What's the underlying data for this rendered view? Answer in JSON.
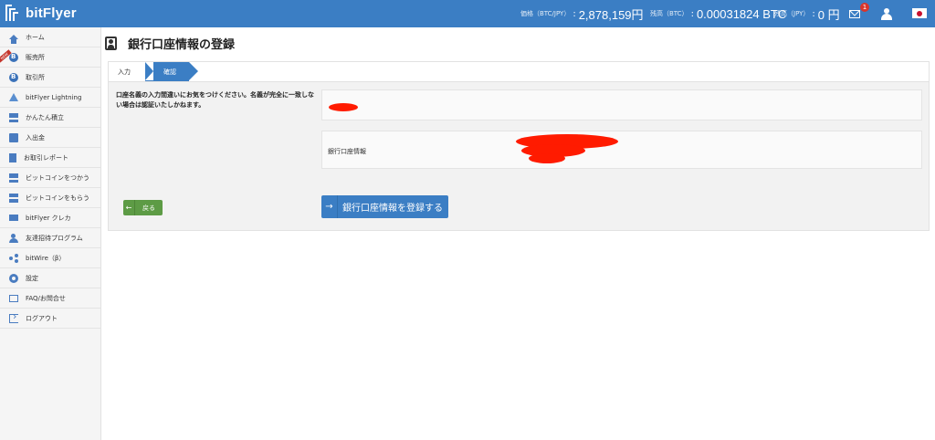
{
  "app": {
    "name": "bitFlyer"
  },
  "header": {
    "price_label": "価格（BTC/JPY）",
    "price_value": "2,878,159円",
    "btc_label": "残高（BTC）",
    "btc_value": "0.00031824 BTC",
    "jpy_label": "残高（JPY）",
    "jpy_value": "0 円",
    "notification_count": "1"
  },
  "sidebar": {
    "ribbon": "NEW",
    "items": [
      {
        "label": "ホーム",
        "icon": "home-icon"
      },
      {
        "label": "販売所",
        "icon": "bitcoin-icon"
      },
      {
        "label": "取引所",
        "icon": "bitcoin-icon"
      },
      {
        "label": "bitFlyer Lightning",
        "icon": "lightning-icon"
      },
      {
        "label": "かんたん積立",
        "icon": "savings-icon"
      },
      {
        "label": "入出金",
        "icon": "deposit-icon"
      },
      {
        "label": "お取引レポート",
        "icon": "report-icon"
      },
      {
        "label": "ビットコインをつかう",
        "icon": "cart-icon"
      },
      {
        "label": "ビットコインをもらう",
        "icon": "gift-icon"
      },
      {
        "label": "bitFlyer クレカ",
        "icon": "credit-card-icon"
      },
      {
        "label": "友達招待プログラム",
        "icon": "invite-icon"
      },
      {
        "label": "bitWire（β）",
        "icon": "share-icon"
      },
      {
        "label": "設定",
        "icon": "gear-icon"
      },
      {
        "label": "FAQ/お問合せ",
        "icon": "mail-icon"
      },
      {
        "label": "ログアウト",
        "icon": "logout-icon"
      }
    ]
  },
  "page": {
    "title": "銀行口座情報の登録",
    "steps": [
      "入力",
      "確認"
    ],
    "notice": "口座名義の入力間違いにお気をつけください。名義が完全に一致しない場合は認証いたしかねます。",
    "bank_info_label": "銀行口座情報",
    "back_label": "戻る",
    "register_label": "銀行口座情報を登録する"
  },
  "colors": {
    "brand": "#3b7ec4",
    "back_button": "#5d9b45",
    "redaction": "#ff1b00"
  }
}
